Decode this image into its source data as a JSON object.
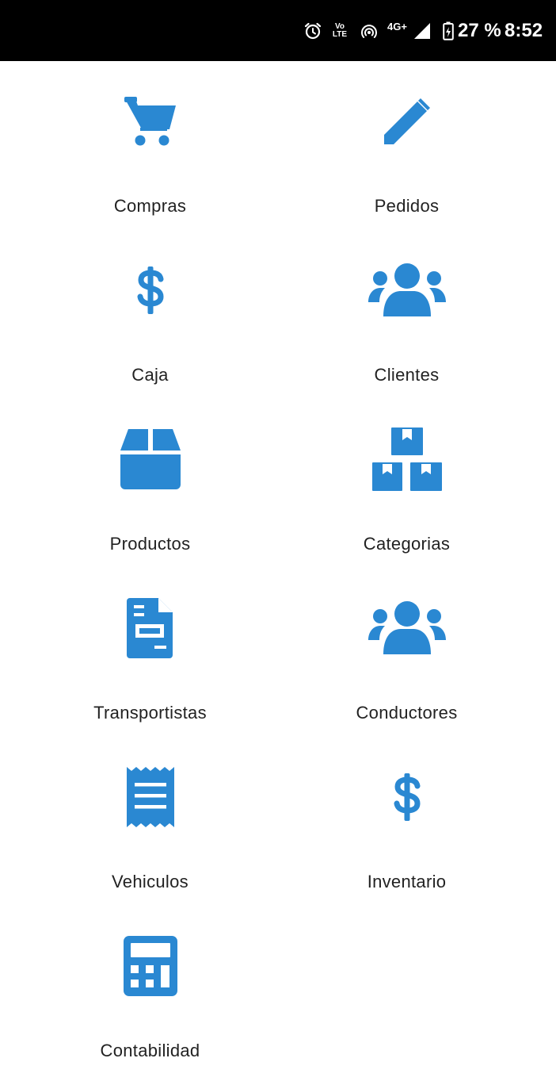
{
  "status_bar": {
    "alarm_icon": "alarm-clock-icon",
    "volte_top": "Vo",
    "volte_bottom": "LTE",
    "hotspot_icon": "hotspot-icon",
    "network_type": "4G+",
    "signal_icon": "signal-icon",
    "battery_icon": "battery-charging-icon",
    "battery_percent": "27 %",
    "time": "8:52"
  },
  "colors": {
    "accent": "#2a88d2",
    "status_bar_bg": "#000000",
    "label": "#222222"
  },
  "menu": {
    "items": [
      {
        "label": "Compras",
        "icon": "shopping-cart-icon"
      },
      {
        "label": "Pedidos",
        "icon": "pencil-icon"
      },
      {
        "label": "Caja",
        "icon": "dollar-icon"
      },
      {
        "label": "Clientes",
        "icon": "users-icon"
      },
      {
        "label": "Productos",
        "icon": "box-icon"
      },
      {
        "label": "Categorias",
        "icon": "boxes-icon"
      },
      {
        "label": "Transportistas",
        "icon": "invoice-icon"
      },
      {
        "label": "Conductores",
        "icon": "users-icon"
      },
      {
        "label": "Vehiculos",
        "icon": "receipt-icon"
      },
      {
        "label": "Inventario",
        "icon": "dollar-icon"
      },
      {
        "label": "Contabilidad",
        "icon": "calculator-icon"
      }
    ]
  }
}
